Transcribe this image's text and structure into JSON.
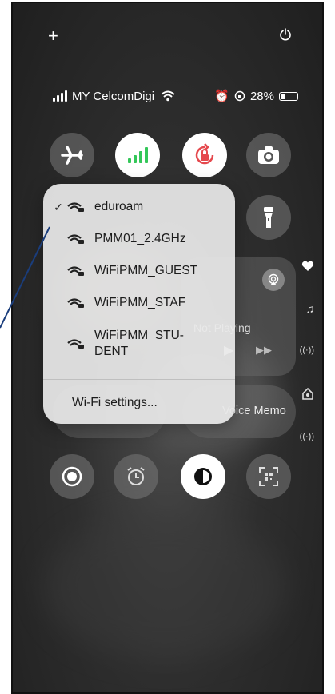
{
  "status_bar": {
    "carrier": "MY CelcomDigi",
    "battery": "28%"
  },
  "wifi_menu": {
    "networks": [
      {
        "name": "eduroam",
        "selected": true
      },
      {
        "name": "PMM01_2.4GHz",
        "selected": false
      },
      {
        "name": "WiFiPMM_GUEST",
        "selected": false
      },
      {
        "name": "WiFiPMM_STAF",
        "selected": false
      },
      {
        "name": "WiFiPMM_STU-",
        "name_line2": "DENT",
        "selected": false
      }
    ],
    "check_mark": "✓",
    "settings_label": "Wi-Fi settings..."
  },
  "media": {
    "now_playing": "Not Playing"
  },
  "tiles": {
    "voice_memo": "Voice Memo"
  },
  "topbar": {
    "plus": "+"
  },
  "colors": {
    "cellular_green": "#34C759",
    "rotation_red": "#E5484D",
    "annotation_line": "#1a3d7c"
  }
}
